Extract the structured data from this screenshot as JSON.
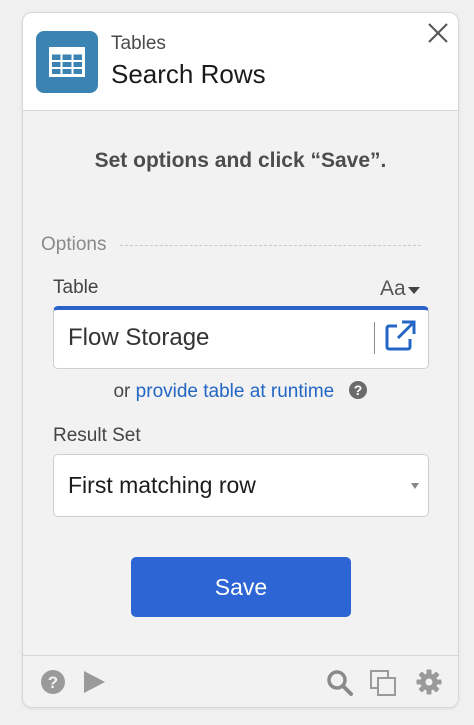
{
  "header": {
    "subtitle": "Tables",
    "title": "Search Rows",
    "icon": "table-icon"
  },
  "instruction": "Set options and click “Save”.",
  "options": {
    "section_label": "Options",
    "table": {
      "label": "Table",
      "mode_toggle": "Aa",
      "value": "Flow Storage",
      "link_icon": "open-external-icon"
    },
    "runtime": {
      "prefix": "or",
      "link": "provide table at runtime"
    },
    "result_set": {
      "label": "Result Set",
      "value": "First matching row"
    }
  },
  "save_label": "Save",
  "colors": {
    "accent": "#2d66d4",
    "tile": "#3a83b3",
    "link": "#2366c4"
  },
  "footer": {
    "icons": [
      "help-icon",
      "play-icon",
      "search-icon",
      "copy-icon",
      "gear-icon"
    ]
  }
}
